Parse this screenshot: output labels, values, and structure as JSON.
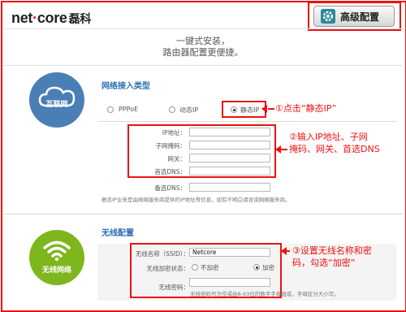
{
  "header": {
    "logo_text_1": "net",
    "logo_dot": "·",
    "logo_text_2": "core",
    "logo_cn": "磊科",
    "advanced_button": "高级配置"
  },
  "slogan": {
    "line1": "一键式安装，",
    "line2": "路由器配置更便捷。"
  },
  "network": {
    "icon_label": "互联网",
    "title": "网络接入类型",
    "options": [
      "PPPoE",
      "动态IP",
      "静态IP"
    ],
    "selected": "静态IP",
    "fields": [
      {
        "label": "IP地址：",
        "value": ""
      },
      {
        "label": "子网掩码：",
        "value": ""
      },
      {
        "label": "网关：",
        "value": ""
      },
      {
        "label": "首选DNS：",
        "value": ""
      },
      {
        "label": "备选DNS：",
        "value": ""
      }
    ],
    "note": "静态IP业务是由网络服务商提供的IP地址等信息，如有不明白请咨询网络服务商。"
  },
  "wireless": {
    "icon_label": "无线网络",
    "title": "无线配置",
    "ssid_label": "无线名称（SSID）：",
    "ssid_value": "Netcore",
    "encrypt_label": "无线加密状态：",
    "encrypt_options": [
      "不加密",
      "加密"
    ],
    "encrypt_selected": "加密",
    "password_label": "无线密码：",
    "password_value": "",
    "password_note": "无线密码可为空或由8-63位的数字字母组成，字母区分大小写。"
  },
  "annotations": {
    "a1": "①点击“静态IP”",
    "a2_line1": "②输入IP地址、子网",
    "a2_line2": "掩码、网关、首选DNS",
    "a3_line1": "③设置无线名称和密",
    "a3_line2": "码，勾选“加密”"
  },
  "colors": {
    "accent_red": "#e11111",
    "title_blue": "#2f6fb0",
    "cloud_blue": "#4a7fb6",
    "wifi_green": "#7eb61d"
  },
  "icons": {
    "advanced": "gear-icon",
    "network": "cloud-icon",
    "wireless": "wifi-icon"
  }
}
